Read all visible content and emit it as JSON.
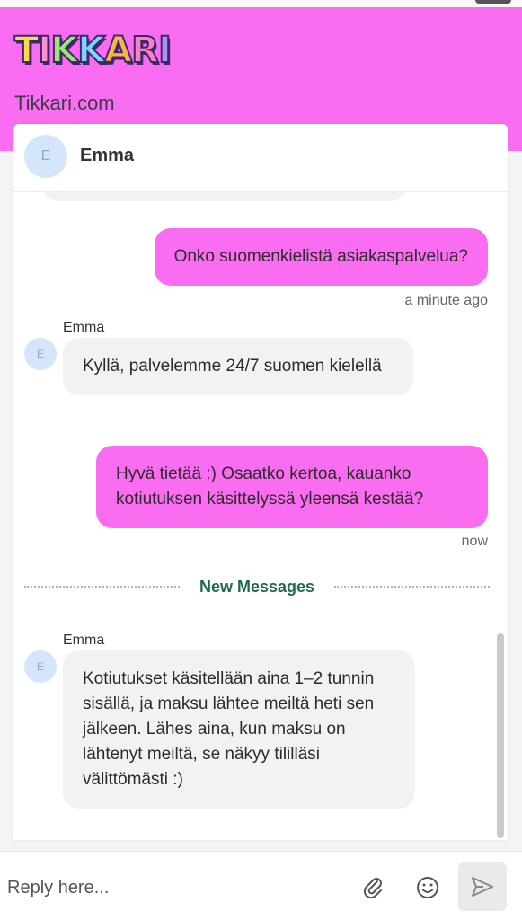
{
  "brand": {
    "logo_text": "TIKKARI",
    "site_name": "Tikkari.com",
    "header_color": "#fb6df0"
  },
  "agent": {
    "initial": "E",
    "name": "Emma"
  },
  "messages": [
    {
      "direction": "out",
      "text": "Onko suomenkielistä asiakaspalvelua?",
      "time": "a minute ago"
    },
    {
      "direction": "in",
      "sender": "Emma",
      "initial": "E",
      "text": "Kyllä, palvelemme 24/7 suomen kielellä"
    },
    {
      "direction": "out",
      "text": "Hyvä tietää :) Osaatko kertoa, kauanko kotiutuksen käsittelyssä yleensä kestää?",
      "time": "now"
    },
    {
      "direction": "in",
      "sender": "Emma",
      "initial": "E",
      "text": "Kotiutukset käsitellään aina 1–2 tunnin sisällä, ja maksu lähtee meiltä heti sen jälkeen. Lähes aina, kun maksu on lähtenyt meiltä, se näkyy tililläsi välittömästi :)"
    }
  ],
  "divider": {
    "label": "New Messages"
  },
  "reply": {
    "placeholder": "Reply here...",
    "icons": [
      "paperclip-icon",
      "smiley-icon",
      "send-icon"
    ]
  }
}
